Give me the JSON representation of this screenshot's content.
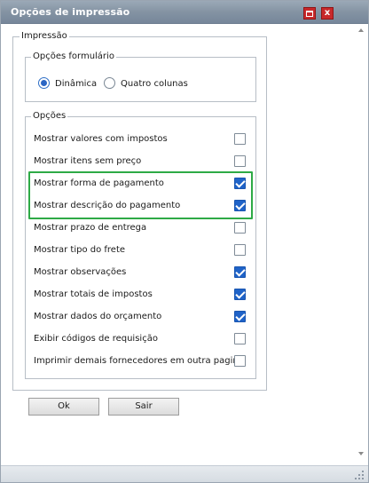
{
  "window": {
    "title": "Opções de impressão",
    "accent_color": "#8493a3",
    "close_glyph": "x"
  },
  "impressao": {
    "legend": "Impressão",
    "opcoes_formulario": {
      "legend": "Opções formulário",
      "options": [
        {
          "label": "Dinâmica",
          "selected": true
        },
        {
          "label": "Quatro colunas",
          "selected": false
        }
      ]
    },
    "opcoes": {
      "legend": "Opções",
      "items": [
        {
          "label": "Mostrar valores com impostos",
          "checked": false
        },
        {
          "label": "Mostrar itens sem preço",
          "checked": false
        },
        {
          "label": "Mostrar forma de pagamento",
          "checked": true
        },
        {
          "label": "Mostrar descrição do pagamento",
          "checked": true
        },
        {
          "label": "Mostrar prazo de entrega",
          "checked": false
        },
        {
          "label": "Mostrar tipo do frete",
          "checked": false
        },
        {
          "label": "Mostrar observações",
          "checked": true
        },
        {
          "label": "Mostrar totais de impostos",
          "checked": true
        },
        {
          "label": "Mostrar dados do orçamento",
          "checked": true
        },
        {
          "label": "Exibir códigos de requisição",
          "checked": false
        },
        {
          "label": "Imprimir demais fornecedores em outra pagina",
          "checked": false
        }
      ],
      "highlight_color": "#2eaa46"
    }
  },
  "buttons": {
    "ok": "Ok",
    "sair": "Sair"
  }
}
